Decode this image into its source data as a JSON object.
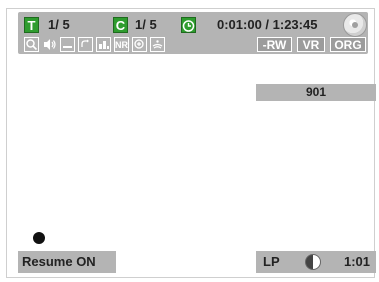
{
  "status": {
    "title_label": "T",
    "title_count": "1/ 5",
    "chapter_label": "C",
    "chapter_count": "1/ 5",
    "time": "0:01:00 / 1:23:45"
  },
  "icons": [
    {
      "name": "search-icon",
      "glyph": "🔍"
    },
    {
      "name": "audio-icon",
      "glyph": "🔊"
    },
    {
      "name": "subtitle-icon",
      "glyph": "▭"
    },
    {
      "name": "repeat-icon",
      "glyph": "↻"
    },
    {
      "name": "angle-icon",
      "glyph": "▦"
    },
    {
      "name": "noise-reduction-icon",
      "glyph": "NR"
    },
    {
      "name": "zoom-icon",
      "glyph": "⊕"
    },
    {
      "name": "surround-icon",
      "glyph": "≋"
    }
  ],
  "format_tags": {
    "rw": "-RW",
    "vr": "VR",
    "org": "ORG"
  },
  "channel": "901",
  "resume": "Resume ON",
  "recording": {
    "mode": "LP",
    "remaining": "1:01"
  },
  "colors": {
    "bar": "#b4b4b4",
    "green": "#2e9c2e",
    "tag": "#9c9c9c"
  }
}
